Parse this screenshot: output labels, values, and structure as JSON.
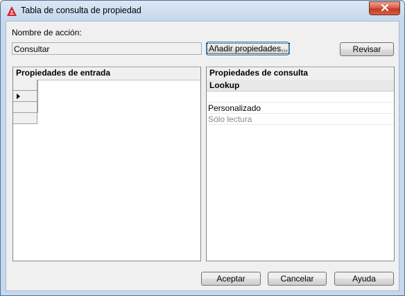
{
  "window": {
    "title": "Tabla de consulta de propiedad",
    "icon": "autocad-icon",
    "close_glyph": "✕"
  },
  "action": {
    "name_label": "Nombre de acción:",
    "name_value": "Consultar",
    "add_properties_label": "Añadir propiedades...",
    "review_label": "Revisar"
  },
  "input_panel": {
    "header": "Propiedades de entrada",
    "rows": [
      "",
      "",
      "",
      ""
    ],
    "current_row_marker": "row-pointer-icon"
  },
  "lookup_panel": {
    "header": "Propiedades de consulta",
    "column_header": "Lookup",
    "rows": [
      "",
      "Personalizado",
      "Sólo lectura"
    ]
  },
  "footer": {
    "ok_label": "Aceptar",
    "cancel_label": "Cancelar",
    "help_label": "Ayuda"
  },
  "colors": {
    "title_gradient": "#c6d8ee",
    "close_button": "#c23b22",
    "readonly_text": "#8a8a8a",
    "icon_red": "#d4202a"
  }
}
